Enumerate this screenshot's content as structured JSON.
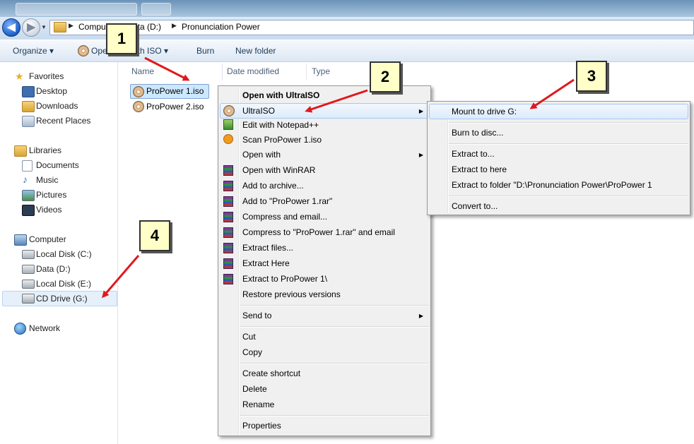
{
  "address": {
    "crumbs": [
      "Compu",
      "ata (D:)",
      "Pronunciation Power"
    ]
  },
  "toolbar": {
    "organize": "Organize ▾",
    "open_prefix": "Ope",
    "open_suffix": "ith ISO ▾",
    "burn": "Burn",
    "new_folder": "New folder"
  },
  "nav": {
    "favorites": "Favorites",
    "desktop": "Desktop",
    "downloads": "Downloads",
    "recent": "Recent Places",
    "libraries": "Libraries",
    "documents": "Documents",
    "music": "Music",
    "pictures": "Pictures",
    "videos": "Videos",
    "computer": "Computer",
    "disk_c": "Local Disk (C:)",
    "data_d": "Data (D:)",
    "disk_e": "Local Disk (E:)",
    "cd_g": "CD Drive (G:)",
    "network": "Network"
  },
  "columns": {
    "name": "Name",
    "date": "Date modified",
    "type": "Type"
  },
  "files": [
    "ProPower 1.iso",
    "ProPower 2.iso"
  ],
  "context_menu": {
    "open_with_ultraiso": "Open with UltraISO",
    "ultraiso": "UltraISO",
    "notepad": "Edit with Notepad++",
    "scan": "Scan ProPower 1.iso",
    "open_with": "Open with",
    "open_winrar": "Open with WinRAR",
    "add_archive": "Add to archive...",
    "add_rar": "Add to \"ProPower 1.rar\"",
    "compress_email": "Compress and email...",
    "compress_rar_email": "Compress to \"ProPower 1.rar\" and email",
    "extract_files": "Extract files...",
    "extract_here": "Extract Here",
    "extract_to": "Extract to ProPower 1\\",
    "restore": "Restore previous versions",
    "send_to": "Send to",
    "cut": "Cut",
    "copy": "Copy",
    "create_shortcut": "Create shortcut",
    "delete": "Delete",
    "rename": "Rename",
    "properties": "Properties"
  },
  "submenu": {
    "mount": "Mount to drive G:",
    "burn": "Burn to disc...",
    "extract_to": "Extract to...",
    "extract_here": "Extract to here",
    "extract_folder": "Extract to folder \"D:\\Pronunciation Power\\ProPower 1",
    "convert": "Convert to..."
  },
  "callouts": [
    "1",
    "2",
    "3",
    "4"
  ],
  "colors": {
    "callout_fill": "#ffffc7",
    "arrow": "#e0191c",
    "menu_highlight": "#dcebfb"
  }
}
